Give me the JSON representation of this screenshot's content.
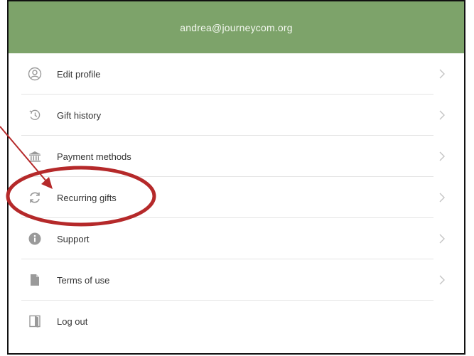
{
  "header": {
    "email": "andrea@journeycom.org",
    "bg_color": "#7da36a"
  },
  "menu": {
    "items": [
      {
        "label": "Edit profile",
        "icon": "user-circle-icon"
      },
      {
        "label": "Gift history",
        "icon": "history-icon"
      },
      {
        "label": "Payment methods",
        "icon": "bank-icon"
      },
      {
        "label": "Recurring gifts",
        "icon": "recurring-icon"
      },
      {
        "label": "Support",
        "icon": "info-icon"
      },
      {
        "label": "Terms of use",
        "icon": "document-icon"
      },
      {
        "label": "Log out",
        "icon": "logout-door-icon"
      }
    ]
  },
  "annotation": {
    "color": "#b5292a",
    "highlight": "Recurring gifts"
  }
}
